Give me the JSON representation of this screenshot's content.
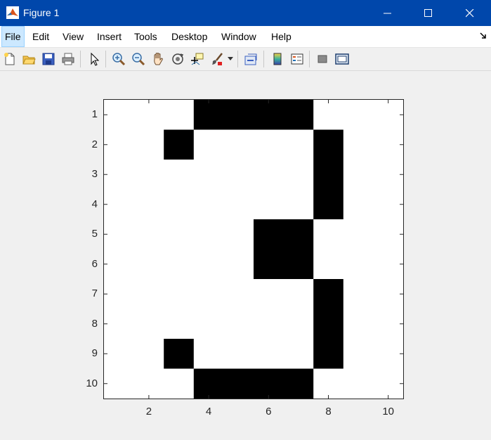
{
  "window": {
    "title": "Figure 1"
  },
  "menu": {
    "items": [
      {
        "label": "File"
      },
      {
        "label": "Edit"
      },
      {
        "label": "View"
      },
      {
        "label": "Insert"
      },
      {
        "label": "Tools"
      },
      {
        "label": "Desktop"
      },
      {
        "label": "Window"
      },
      {
        "label": "Help"
      }
    ]
  },
  "toolbar": {
    "icons": [
      "new-figure-icon",
      "open-file-icon",
      "save-icon",
      "print-icon",
      "select-pointer-icon",
      "zoom-in-icon",
      "zoom-out-icon",
      "pan-hand-icon",
      "rotate-3d-icon",
      "data-cursor-icon",
      "brush-icon",
      "brush-dropdown-icon",
      "link-plot-icon",
      "colorbar-icon",
      "legend-icon",
      "hide-plot-tools-icon",
      "show-plot-tools-icon"
    ]
  },
  "chart_data": {
    "type": "heatmap",
    "title": "",
    "xlabel": "",
    "ylabel": "",
    "xlim": [
      0.5,
      10.5
    ],
    "ylim": [
      0.5,
      10.5
    ],
    "y_reversed": true,
    "xticks": [
      "2",
      "4",
      "6",
      "8",
      "10"
    ],
    "yticks": [
      "1",
      "2",
      "3",
      "4",
      "5",
      "6",
      "7",
      "8",
      "9",
      "10"
    ],
    "colormap": {
      "0": "#000000",
      "1": "#ffffff"
    },
    "matrix": [
      [
        1,
        1,
        1,
        0,
        0,
        0,
        0,
        1,
        1,
        1
      ],
      [
        1,
        1,
        0,
        1,
        1,
        1,
        1,
        0,
        1,
        1
      ],
      [
        1,
        1,
        1,
        1,
        1,
        1,
        1,
        0,
        1,
        1
      ],
      [
        1,
        1,
        1,
        1,
        1,
        1,
        1,
        0,
        1,
        1
      ],
      [
        1,
        1,
        1,
        1,
        1,
        0,
        0,
        1,
        1,
        1
      ],
      [
        1,
        1,
        1,
        1,
        1,
        0,
        0,
        1,
        1,
        1
      ],
      [
        1,
        1,
        1,
        1,
        1,
        1,
        1,
        0,
        1,
        1
      ],
      [
        1,
        1,
        1,
        1,
        1,
        1,
        1,
        0,
        1,
        1
      ],
      [
        1,
        1,
        0,
        1,
        1,
        1,
        1,
        0,
        1,
        1
      ],
      [
        1,
        1,
        1,
        0,
        0,
        0,
        0,
        1,
        1,
        1
      ]
    ]
  }
}
